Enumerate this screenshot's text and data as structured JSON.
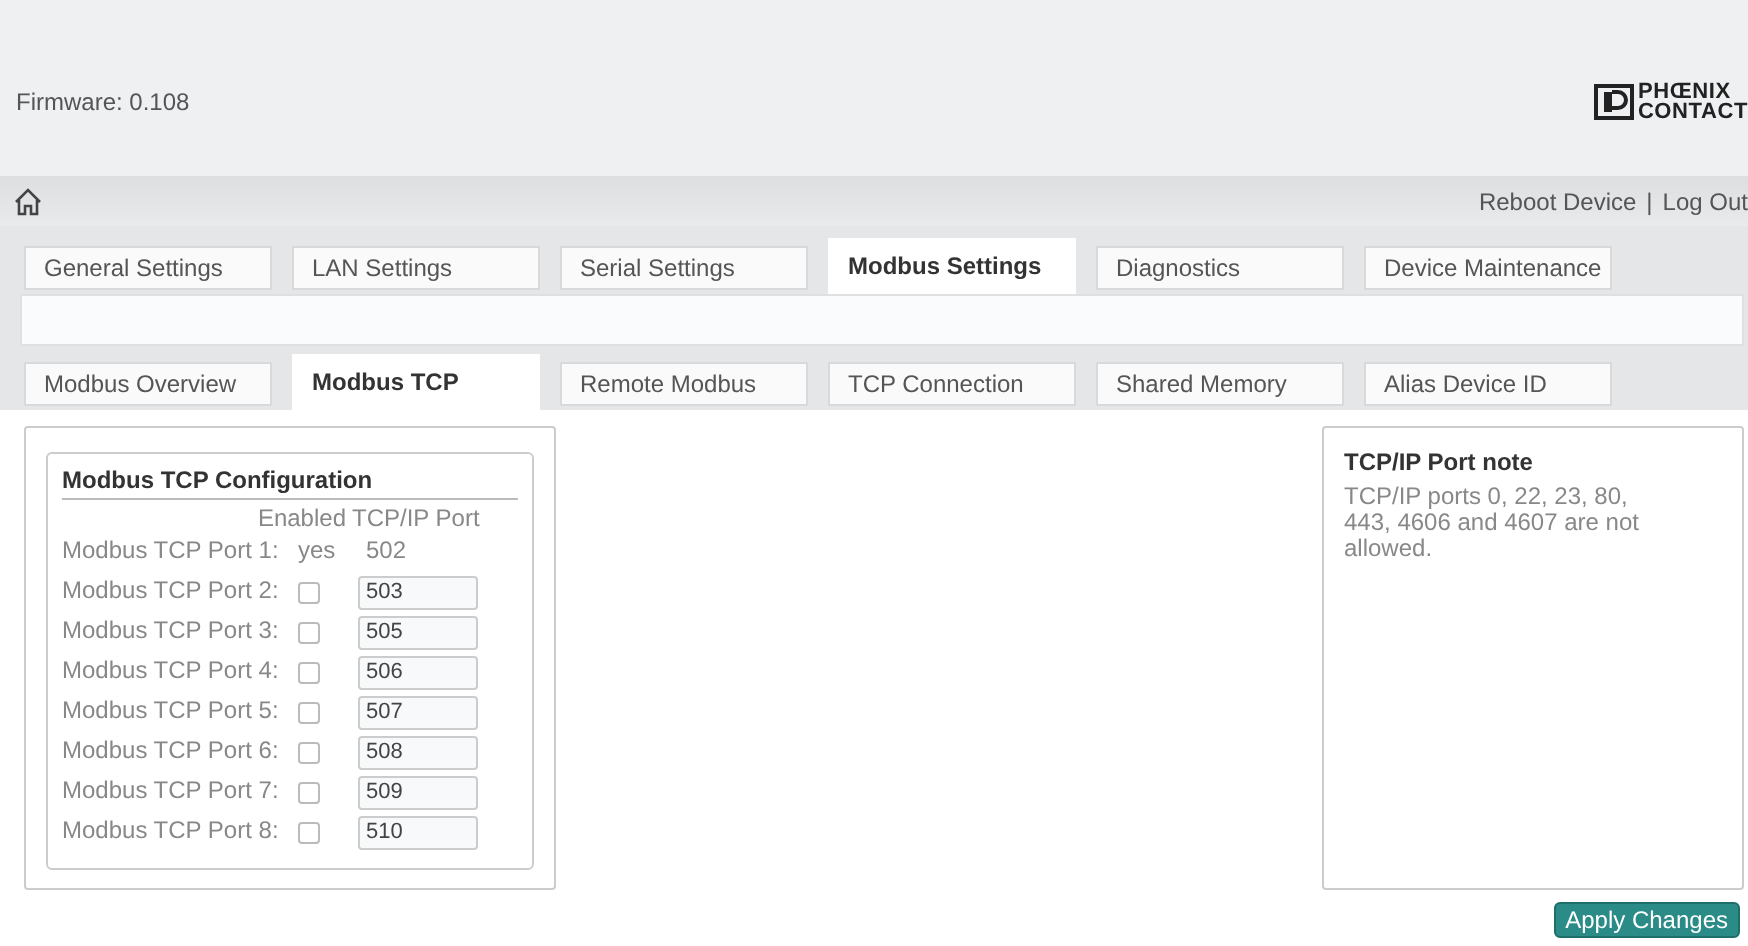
{
  "header": {
    "firmware": "Firmware: 0.108",
    "logo": [
      "PHŒNIX",
      "CONTACT"
    ]
  },
  "nav": {
    "links": [
      "Reboot Device",
      "Log Out"
    ],
    "separator": "|"
  },
  "tabs": [
    {
      "label": "General Settings",
      "selected": false
    },
    {
      "label": "LAN Settings",
      "selected": false
    },
    {
      "label": "Serial Settings",
      "selected": false
    },
    {
      "label": "Modbus Settings",
      "selected": true
    },
    {
      "label": "Diagnostics",
      "selected": false
    },
    {
      "label": "Device Maintenance",
      "selected": false
    }
  ],
  "subtabs": [
    {
      "label": "Modbus Overview",
      "selected": false
    },
    {
      "label": "Modbus TCP",
      "selected": true
    },
    {
      "label": "Remote Modbus",
      "selected": false
    },
    {
      "label": "TCP Connection",
      "selected": false
    },
    {
      "label": "Shared Memory",
      "selected": false
    },
    {
      "label": "Alias Device ID",
      "selected": false
    }
  ],
  "config": {
    "title": "Modbus TCP Configuration",
    "columns": [
      "Enabled",
      "TCP/IP Port"
    ],
    "rows": [
      {
        "kind": "fixed",
        "label": "Modbus TCP Port 1:",
        "enabled": "yes",
        "port": "502"
      },
      {
        "kind": "editable",
        "label": "Modbus TCP Port 2:",
        "checked": false,
        "port": "503"
      },
      {
        "kind": "editable",
        "label": "Modbus TCP Port 3:",
        "checked": false,
        "port": "505"
      },
      {
        "kind": "editable",
        "label": "Modbus TCP Port 4:",
        "checked": false,
        "port": "506"
      },
      {
        "kind": "editable",
        "label": "Modbus TCP Port 5:",
        "checked": false,
        "port": "507"
      },
      {
        "kind": "editable",
        "label": "Modbus TCP Port 6:",
        "checked": false,
        "port": "508"
      },
      {
        "kind": "editable",
        "label": "Modbus TCP Port 7:",
        "checked": false,
        "port": "509"
      },
      {
        "kind": "editable",
        "label": "Modbus TCP Port 8:",
        "checked": false,
        "port": "510"
      }
    ]
  },
  "note": {
    "title": "TCP/IP Port note",
    "text": "TCP/IP ports 0, 22, 23, 80, 443, 4606 and 4607 are not allowed."
  },
  "apply_button": "Apply Changes"
}
